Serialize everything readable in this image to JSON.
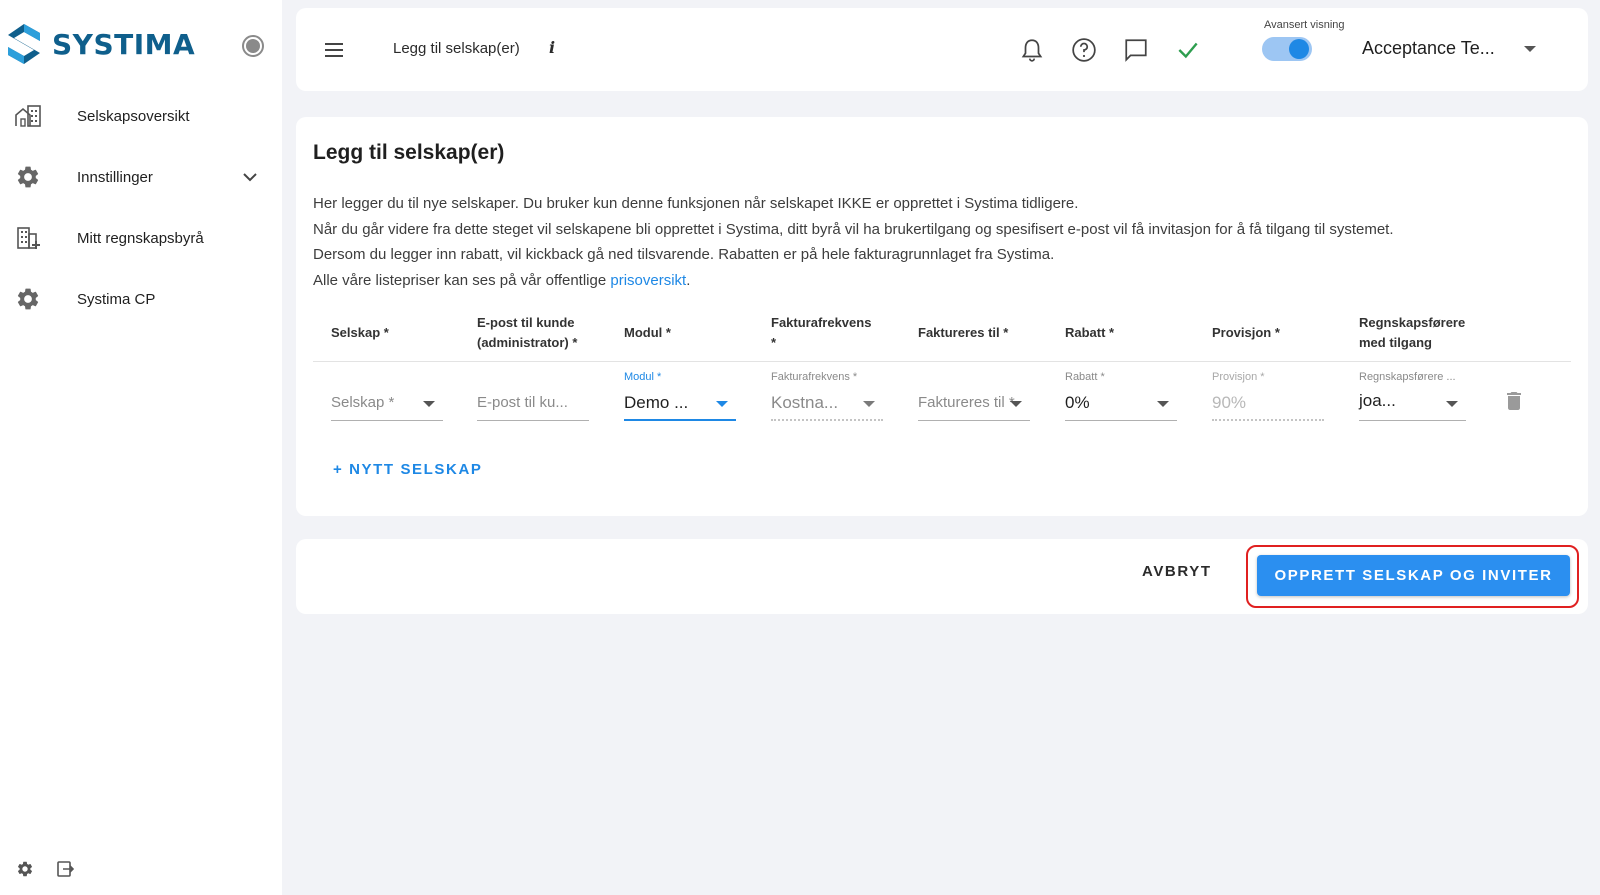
{
  "brand": {
    "name": "SYSTIMA",
    "color": "#0f5f8c"
  },
  "sidebar": {
    "items": [
      {
        "label": "Selskapsoversikt",
        "icon": "building-icon"
      },
      {
        "label": "Innstillinger",
        "icon": "gear-icon",
        "expandable": true
      },
      {
        "label": "Mitt regnskapsbyrå",
        "icon": "office-add-icon"
      },
      {
        "label": "Systima CP",
        "icon": "gear-icon"
      }
    ],
    "bottom_icons": [
      "settings-icon",
      "logout-icon"
    ]
  },
  "topbar": {
    "title": "Legg til selskap(er)",
    "info": "i",
    "icons": [
      "bell-icon",
      "help-icon",
      "chat-icon",
      "check-icon"
    ],
    "toggle_label": "Avansert visning",
    "toggle_on": true,
    "account": "Acceptance Te..."
  },
  "card": {
    "title": "Legg til selskap(er)",
    "desc_lines": [
      "Her legger du til nye selskaper. Du bruker kun denne funksjonen når selskapet IKKE er opprettet i Systima tidligere.",
      "Når du går videre fra dette steget vil selskapene bli opprettet i Systima, ditt byrå vil ha brukertilgang og spesifisert e-post vil få invitasjon for å få tilgang til systemet.",
      "Dersom du legger inn rabatt, vil kickback gå ned tilsvarende. Rabatten er på hele fakturagrunnlaget fra Systima."
    ],
    "desc_last_prefix": "Alle våre listepriser kan ses på vår offentlige ",
    "desc_link": "prisoversikt",
    "desc_last_suffix": ".",
    "columns": [
      {
        "line1": "Selskap *",
        "line2": ""
      },
      {
        "line1": "E-post til kunde",
        "line2": "(administrator) *"
      },
      {
        "line1": "Modul *",
        "line2": ""
      },
      {
        "line1": "Fakturafrekvens",
        "line2": "*"
      },
      {
        "line1": "Faktureres til *",
        "line2": ""
      },
      {
        "line1": "Rabatt *",
        "line2": ""
      },
      {
        "line1": "Provisjon *",
        "line2": ""
      },
      {
        "line1": "Regnskapsførere",
        "line2": "med tilgang"
      }
    ],
    "row": {
      "selskap_placeholder": "Selskap *",
      "epost_placeholder": "E-post til ku...",
      "modul_label": "Modul *",
      "modul_value": "Demo ...",
      "frekvens_label": "Fakturafrekvens *",
      "frekvens_value": "Kostna...",
      "faktureres_placeholder": "Faktureres til *",
      "rabatt_label": "Rabatt *",
      "rabatt_value": "0%",
      "provisjon_label": "Provisjon *",
      "provisjon_value": "90%",
      "regnskap_label": "Regnskapsførere ...",
      "regnskap_value": "joa..."
    },
    "add_company": "+ NYTT SELSKAP"
  },
  "footer": {
    "cancel": "AVBRYT",
    "primary": "OPPRETT SELSKAP OG INVITER"
  },
  "colors": {
    "accent": "#1e88e5",
    "highlight": "#e02020",
    "success": "#2e9e4f"
  }
}
